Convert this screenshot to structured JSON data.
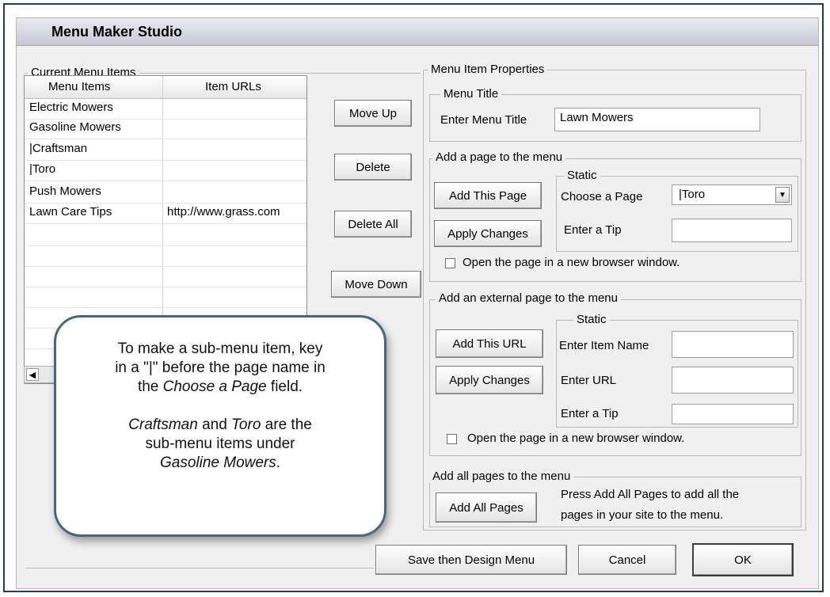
{
  "window": {
    "title": "Menu Maker Studio"
  },
  "current_menu_items": {
    "group_label": "Current Menu Items",
    "columns": [
      "Menu Items",
      "Item URLs"
    ],
    "rows": [
      {
        "item": "Electric Mowers",
        "url": ""
      },
      {
        "item": "Gasoline Mowers",
        "url": ""
      },
      {
        "item": "|Craftsman",
        "url": ""
      },
      {
        "item": "|Toro",
        "url": ""
      },
      {
        "item": "Push Mowers",
        "url": ""
      },
      {
        "item": "Lawn Care Tips",
        "url": "http://www.grass.com"
      }
    ]
  },
  "list_buttons": {
    "move_up": "Move Up",
    "delete": "Delete",
    "delete_all": "Delete All",
    "move_down": "Move Down"
  },
  "properties": {
    "group_label": "Menu Item Properties",
    "menu_title": {
      "group_label": "Menu Title",
      "field_label": "Enter Menu Title",
      "value": "Lawn Mowers"
    },
    "add_page": {
      "group_label": "Add a page to the menu",
      "add_button": "Add This Page",
      "apply_button": "Apply Changes",
      "static_label": "Static",
      "choose_label": "Choose a Page",
      "choose_value": "|Toro",
      "tip_label": "Enter a Tip",
      "tip_value": "",
      "new_window_label": "Open the page in a new browser window."
    },
    "add_external": {
      "group_label": "Add an external page to the menu",
      "add_button": "Add This URL",
      "apply_button": "Apply Changes",
      "static_label": "Static",
      "name_label": "Enter Item Name",
      "name_value": "",
      "url_label": "Enter URL",
      "url_value": "",
      "tip_label": "Enter a Tip",
      "tip_value": "",
      "new_window_label": "Open the page in a new browser window."
    },
    "add_all": {
      "group_label": "Add all pages to the menu",
      "button": "Add All Pages",
      "description_line1": "Press Add All Pages to add all the",
      "description_line2": "pages in your site to the menu."
    }
  },
  "footer": {
    "save_design": "Save then Design Menu",
    "cancel": "Cancel",
    "ok": "OK"
  },
  "callout": {
    "line1": "To make a sub-menu item, key",
    "line2": "in a \"|\" before the page name in",
    "line3_prefix": "the ",
    "line3_em": "Choose a Page",
    "line3_suffix": " field.",
    "line4_em1": "Craftsman",
    "line4_mid": " and ",
    "line4_em2": "Toro",
    "line4_suffix": " are the",
    "line5": "sub-menu items under",
    "line6_em": "Gasoline Mowers",
    "line6_suffix": "."
  },
  "colors": {
    "frame": "#1f3d63",
    "dialog_bg": "#f0f0f0",
    "callout_border": "#4a6583"
  }
}
